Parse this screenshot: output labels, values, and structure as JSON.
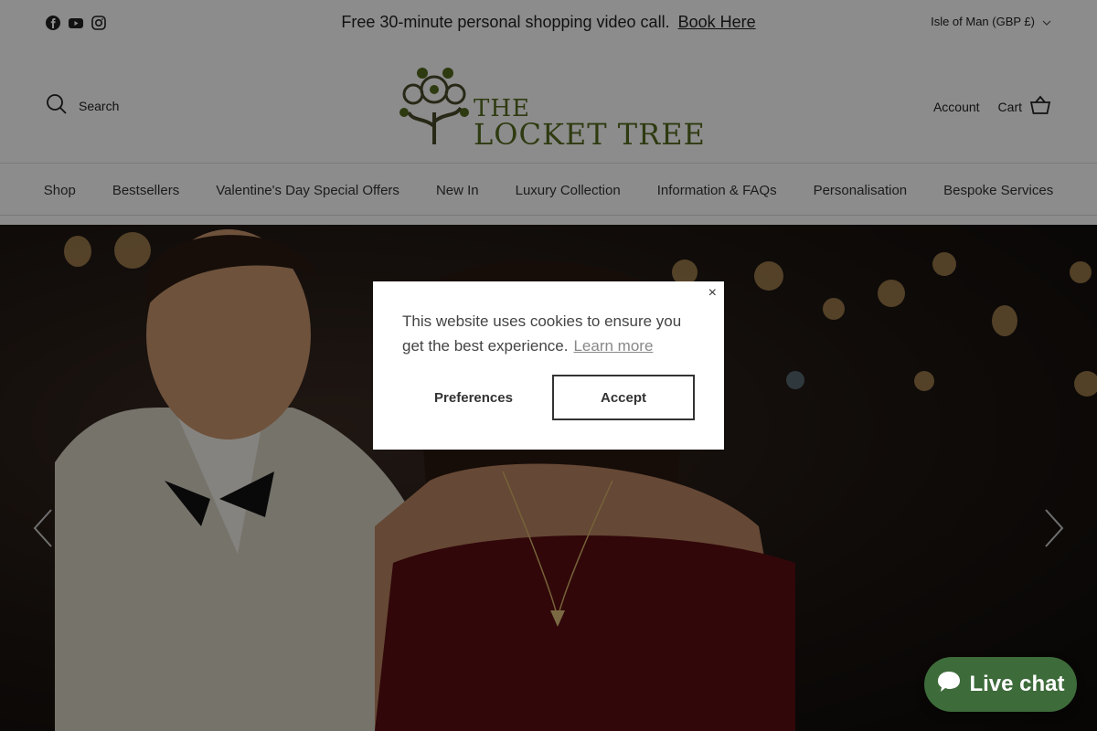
{
  "announcement": {
    "text": "Free 30-minute personal shopping video call.",
    "link": "Book Here",
    "region": "Isle of Man (GBP £)"
  },
  "social": [
    "facebook-icon",
    "youtube-icon",
    "instagram-icon"
  ],
  "header": {
    "search_label": "Search",
    "logo_line1": "THE",
    "logo_line2": "LOCKET TREE",
    "account_label": "Account",
    "cart_label": "Cart"
  },
  "nav": {
    "items": [
      "Shop",
      "Bestsellers",
      "Valentine's Day Special Offers",
      "New In",
      "Luxury Collection",
      "Information & FAQs",
      "Personalisation",
      "Bespoke Services"
    ]
  },
  "cookie": {
    "message": "This website uses cookies to ensure you get the best experience.",
    "learn_more": "Learn more",
    "preferences": "Preferences",
    "accept": "Accept",
    "close": "×"
  },
  "chat": {
    "label": "Live chat"
  },
  "colors": {
    "brand_green": "#556b1e",
    "chat_green": "#3d6b3a"
  }
}
